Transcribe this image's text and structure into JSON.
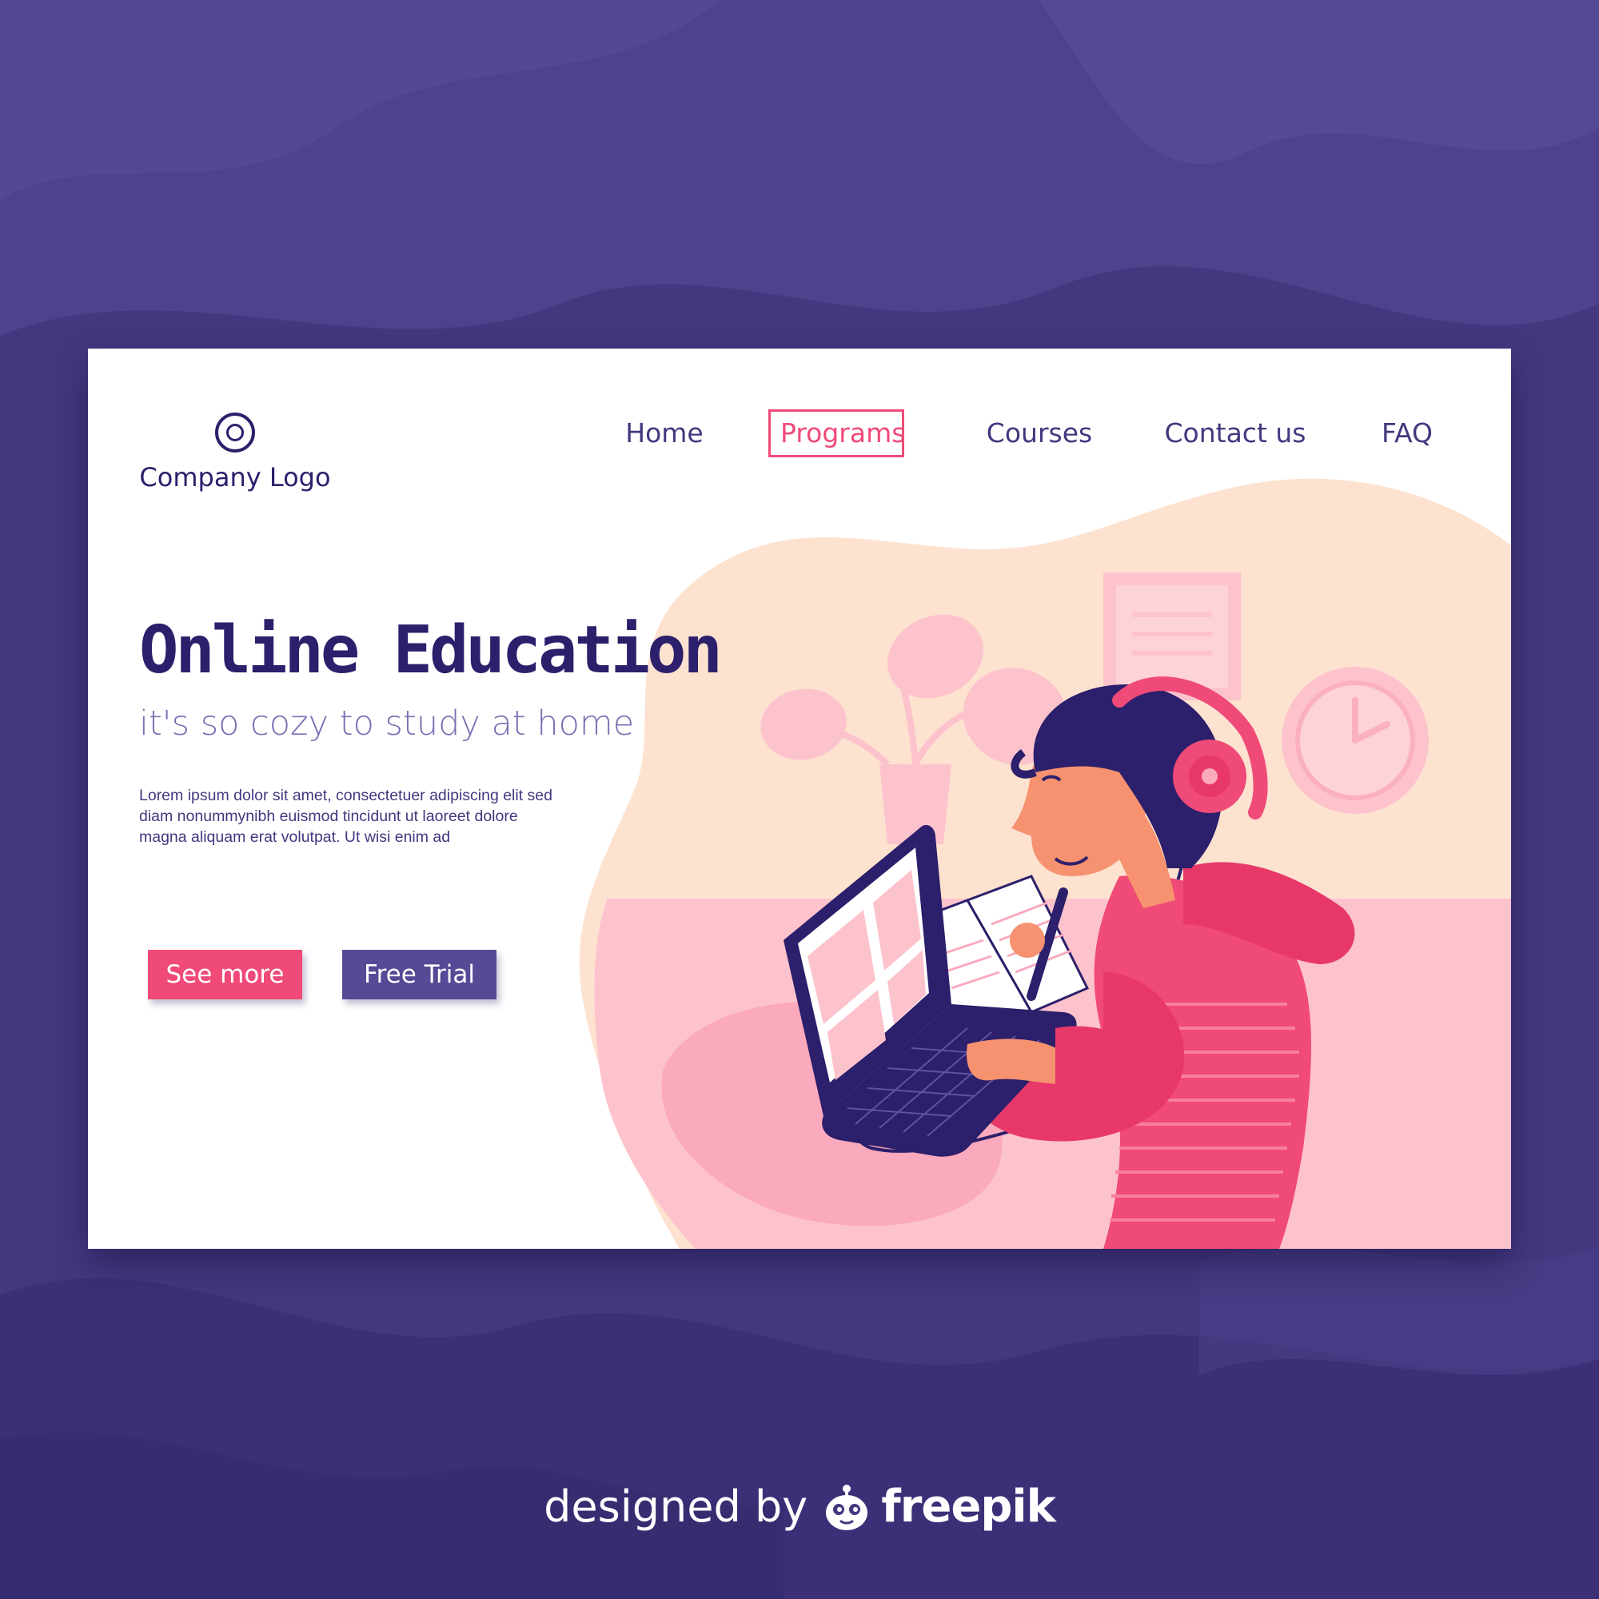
{
  "colors": {
    "background": "#43387f",
    "accent_pink": "#f04a78",
    "accent_purple": "#544a95",
    "heading": "#2c1f6b",
    "subheading": "#7b6fb3",
    "blob_peach": "#fde2cf",
    "blob_pink": "#fdc3cd"
  },
  "logo": {
    "icon": "circle-logo-icon",
    "text": "Company Logo"
  },
  "nav": {
    "items": [
      {
        "label": "Home",
        "active": false
      },
      {
        "label": "Programs",
        "active": true
      },
      {
        "label": "Courses",
        "active": false
      },
      {
        "label": "Contact us",
        "active": false
      },
      {
        "label": "FAQ",
        "active": false
      }
    ]
  },
  "hero": {
    "title": "Online Education",
    "subtitle": "it's so cozy to study at home",
    "body": "Lorem ipsum dolor sit amet, consectetuer adipiscing elit sed diam nonummynibh euismod tincidunt ut laoreet dolore magna aliquam erat volutpat. Ut wisi enim ad",
    "primary_button": "See more",
    "secondary_button": "Free Trial"
  },
  "illustration": {
    "icons": [
      "student-illustration",
      "laptop-icon",
      "headphones-icon",
      "wall-clock-icon",
      "potted-plant-icon",
      "wall-note-icon",
      "notebook-icon"
    ]
  },
  "footer": {
    "prefix": "designed by",
    "brand": "freepik",
    "mascot_icon": "freepik-mascot-icon"
  }
}
